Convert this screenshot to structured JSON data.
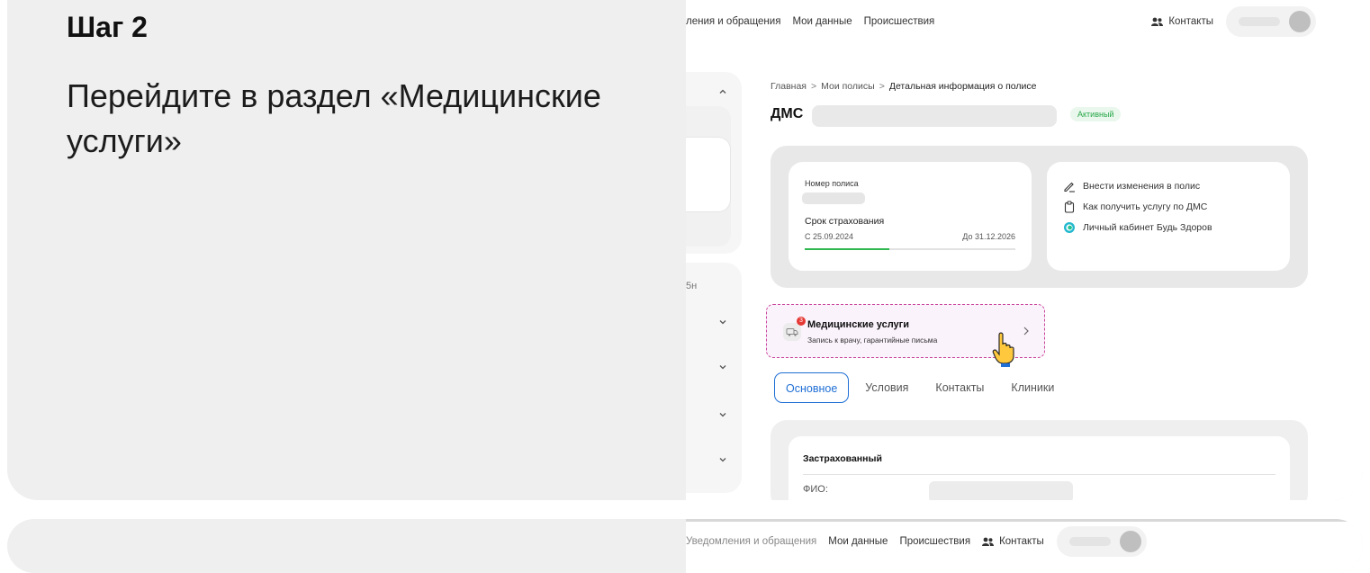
{
  "step": {
    "title": "Шаг 2",
    "description": "Перейдите в раздел «Медицинские услуги»"
  },
  "topnav": {
    "items": [
      "ления и обращения",
      "Мои данные",
      "Происшествия"
    ],
    "contacts": "Контакты"
  },
  "topnav2": {
    "items": [
      "Уведомления и обращения",
      "Мои данные",
      "Происшествия"
    ],
    "contacts": "Контакты"
  },
  "sidebar": {
    "cut_text": "5н"
  },
  "breadcrumb": {
    "home": "Главная",
    "policies": "Мои полисы",
    "current": "Детальная информация о полисе",
    "separator": ">"
  },
  "policy": {
    "type": "ДМС",
    "status": "Активный",
    "number_label": "Номер полиса",
    "term_label": "Срок страхования",
    "term_from": "С 25.09.2024",
    "term_to": "До 31.12.2026",
    "term_progress": 0.4
  },
  "links": [
    {
      "icon": "pencil-icon",
      "label": "Внести изменения в полис"
    },
    {
      "icon": "clipboard-icon",
      "label": "Как получить услугу по ДМС"
    },
    {
      "icon": "bud-zdorov-logo-icon",
      "label": "Личный кабинет Будь Здоров"
    }
  ],
  "medical_services": {
    "badge_count": "3",
    "title": "Медицинские услуги",
    "subtitle": "Запись к врачу, гарантийные письма"
  },
  "tabs": [
    {
      "label": "Основное",
      "active": true
    },
    {
      "label": "Условия",
      "active": false
    },
    {
      "label": "Контакты",
      "active": false
    },
    {
      "label": "Клиники",
      "active": false
    }
  ],
  "insured": {
    "title": "Застрахованный",
    "fio_label": "ФИО:"
  },
  "colors": {
    "accent_blue": "#1f6fd6",
    "status_green": "#2aa84a",
    "highlight_border": "#c9459c",
    "badge_red": "#e53935"
  }
}
